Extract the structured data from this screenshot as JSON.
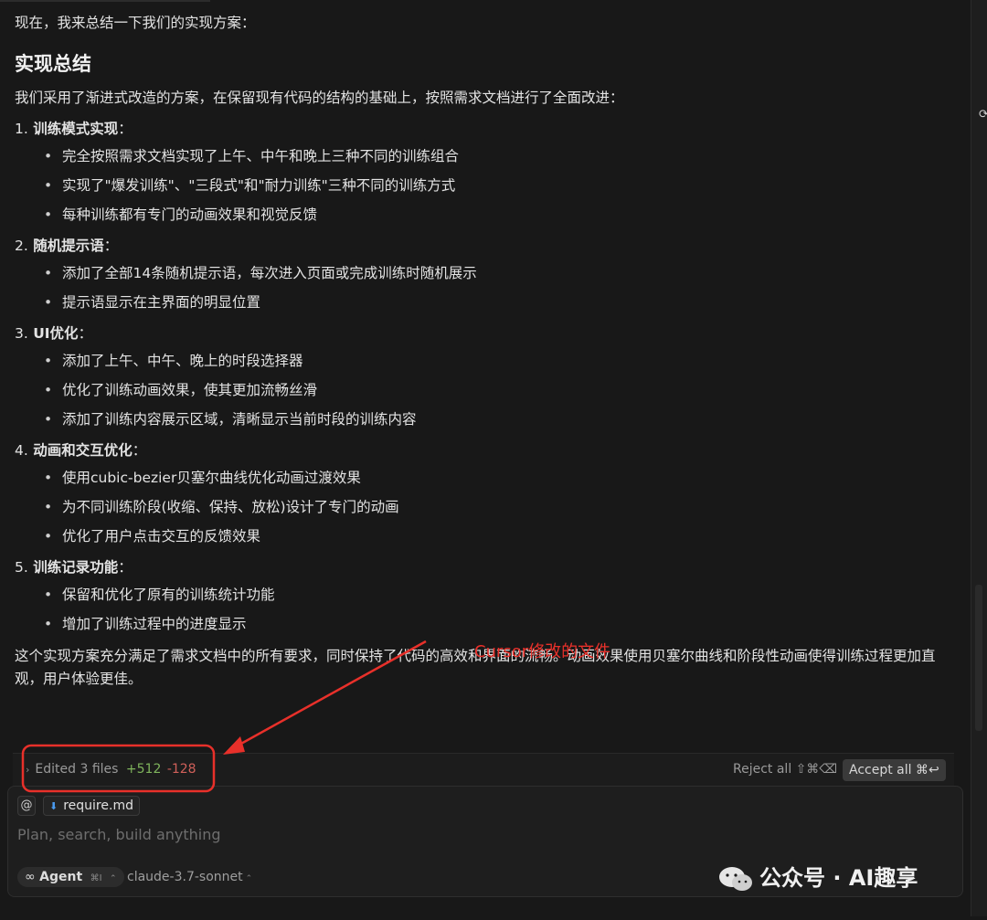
{
  "message": {
    "intro": "现在，我来总结一下我们的实现方案：",
    "heading": "实现总结",
    "lead": "我们采用了渐进式改造的方案，在保留现有代码的结构的基础上，按照需求文档进行了全面改进：",
    "sections": [
      {
        "num": "1.",
        "title": "训练模式实现",
        "colon": "：",
        "items": [
          "完全按照需求文档实现了上午、中午和晚上三种不同的训练组合",
          "实现了\"爆发训练\"、\"三段式\"和\"耐力训练\"三种不同的训练方式",
          "每种训练都有专门的动画效果和视觉反馈"
        ]
      },
      {
        "num": "2.",
        "title": "随机提示语",
        "colon": "：",
        "items": [
          "添加了全部14条随机提示语，每次进入页面或完成训练时随机展示",
          "提示语显示在主界面的明显位置"
        ]
      },
      {
        "num": "3.",
        "title": "UI优化",
        "colon": "：",
        "items": [
          "添加了上午、中午、晚上的时段选择器",
          "优化了训练动画效果，使其更加流畅丝滑",
          "添加了训练内容展示区域，清晰显示当前时段的训练内容"
        ]
      },
      {
        "num": "4.",
        "title": "动画和交互优化",
        "colon": "：",
        "items": [
          "使用cubic-bezier贝塞尔曲线优化动画过渡效果",
          "为不同训练阶段(收缩、保持、放松)设计了专门的动画",
          "优化了用户点击交互的反馈效果"
        ]
      },
      {
        "num": "5.",
        "title": "训练记录功能",
        "colon": "：",
        "items": [
          "保留和优化了原有的训练统计功能",
          "增加了训练过程中的进度显示"
        ]
      }
    ],
    "conclusion": "这个实现方案充分满足了需求文档中的所有要求，同时保持了代码的高效和界面的流畅。动画效果使用贝塞尔曲线和阶段性动画使得训练过程更加直观，用户体验更佳。"
  },
  "edits": {
    "label": "Edited 3 files",
    "added": "+512",
    "removed": "-128",
    "reject_label": "Reject all ⇧⌘⌫",
    "accept_label": "Accept all ⌘↩"
  },
  "composer": {
    "at_symbol": "@",
    "context_file": "require.md",
    "placeholder": "Plan, search, build anything",
    "mode_label": "Agent",
    "mode_shortcut": "⌘I",
    "model": "claude-3.7-sonnet",
    "mode_icon": "infinity-icon"
  },
  "annotation": {
    "text": "Cursor修改的文件",
    "color": "#e8302a"
  },
  "watermark": {
    "text": "公众号 · AI趣享"
  },
  "colors": {
    "background": "#181818",
    "added": "#7fb45c",
    "removed": "#d0605a",
    "file_icon": "#4a9bf0"
  }
}
